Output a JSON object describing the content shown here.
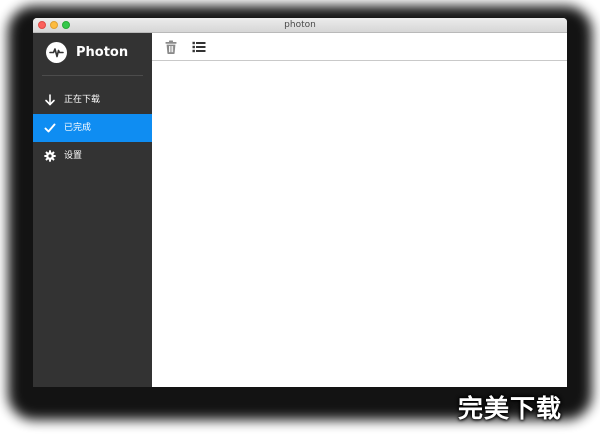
{
  "window": {
    "title": "photon"
  },
  "sidebar": {
    "brand_name": "Photon",
    "items": [
      {
        "label": "正在下载",
        "icon": "arrow-down-icon",
        "active": false
      },
      {
        "label": "已完成",
        "icon": "checkmark-icon",
        "active": true
      },
      {
        "label": "设置",
        "icon": "gear-icon",
        "active": false
      }
    ]
  },
  "toolbar": {
    "buttons": [
      {
        "icon": "trash-icon"
      },
      {
        "icon": "list-icon"
      }
    ]
  },
  "watermark": {
    "text": "完美下载"
  },
  "colors": {
    "sidebar_bg": "#333333",
    "active_item": "#0f8df2",
    "text_light": "#ffffff",
    "toolbar_icon": "#8a8a8a",
    "list_icon": "#333333"
  }
}
